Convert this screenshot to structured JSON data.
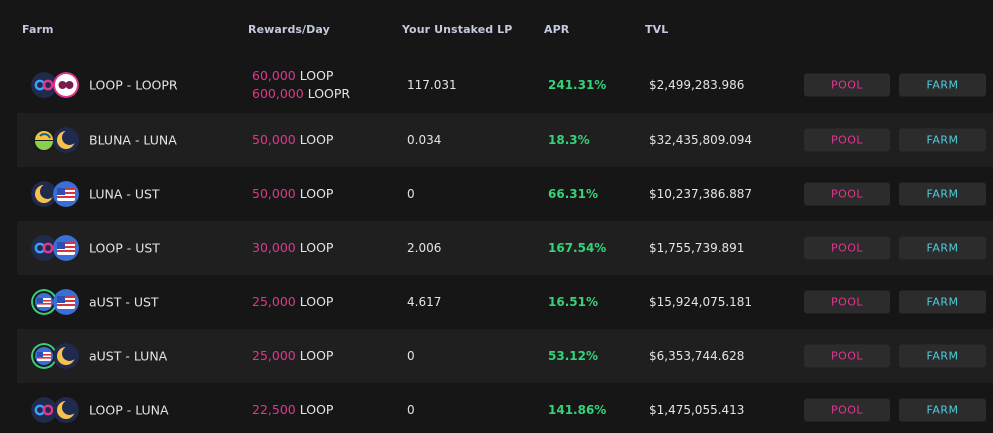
{
  "headers": {
    "farm": "Farm",
    "rewards": "Rewards/Day",
    "lp": "Your Unstaked LP",
    "apr": "APR",
    "tvl": "TVL"
  },
  "rows": [
    {
      "pair": "LOOP - LOOPR",
      "icons": [
        "loop-icon",
        "loopr-icon"
      ],
      "rewards": [
        {
          "amount": "60,000",
          "token": "LOOP"
        },
        {
          "amount": "600,000",
          "token": "LOOPR"
        }
      ],
      "lp": "117.031",
      "apr": "241.31%",
      "tvl": "$2,499,283.986",
      "pool_label": "POOL",
      "farm_label": "FARM"
    },
    {
      "pair": "BLUNA - LUNA",
      "icons": [
        "bluna-icon",
        "luna-icon"
      ],
      "rewards": [
        {
          "amount": "50,000",
          "token": "LOOP"
        }
      ],
      "lp": "0.034",
      "apr": "18.3%",
      "tvl": "$32,435,809.094",
      "pool_label": "POOL",
      "farm_label": "FARM"
    },
    {
      "pair": "LUNA - UST",
      "icons": [
        "luna-icon",
        "ust-icon"
      ],
      "rewards": [
        {
          "amount": "50,000",
          "token": "LOOP"
        }
      ],
      "lp": "0",
      "apr": "66.31%",
      "tvl": "$10,237,386.887",
      "pool_label": "POOL",
      "farm_label": "FARM"
    },
    {
      "pair": "LOOP - UST",
      "icons": [
        "loop-icon",
        "ust-icon"
      ],
      "rewards": [
        {
          "amount": "30,000",
          "token": "LOOP"
        }
      ],
      "lp": "2.006",
      "apr": "167.54%",
      "tvl": "$1,755,739.891",
      "pool_label": "POOL",
      "farm_label": "FARM"
    },
    {
      "pair": "aUST - UST",
      "icons": [
        "aust-icon",
        "ust-icon"
      ],
      "rewards": [
        {
          "amount": "25,000",
          "token": "LOOP"
        }
      ],
      "lp": "4.617",
      "apr": "16.51%",
      "tvl": "$15,924,075.181",
      "pool_label": "POOL",
      "farm_label": "FARM"
    },
    {
      "pair": "aUST - LUNA",
      "icons": [
        "aust-icon",
        "luna-icon"
      ],
      "rewards": [
        {
          "amount": "25,000",
          "token": "LOOP"
        }
      ],
      "lp": "0",
      "apr": "53.12%",
      "tvl": "$6,353,744.628",
      "pool_label": "POOL",
      "farm_label": "FARM"
    },
    {
      "pair": "LOOP - LUNA",
      "icons": [
        "loop-icon",
        "luna-icon"
      ],
      "rewards": [
        {
          "amount": "22,500",
          "token": "LOOP"
        }
      ],
      "lp": "0",
      "apr": "141.86%",
      "tvl": "$1,475,055.413",
      "pool_label": "POOL",
      "farm_label": "FARM"
    }
  ],
  "colors": {
    "background": "#161616",
    "row_alt": "#1f1f1f",
    "reward_amount": "#e0368f",
    "apr": "#35d27a",
    "pool": "#e0368f",
    "farm": "#4ecdde"
  }
}
